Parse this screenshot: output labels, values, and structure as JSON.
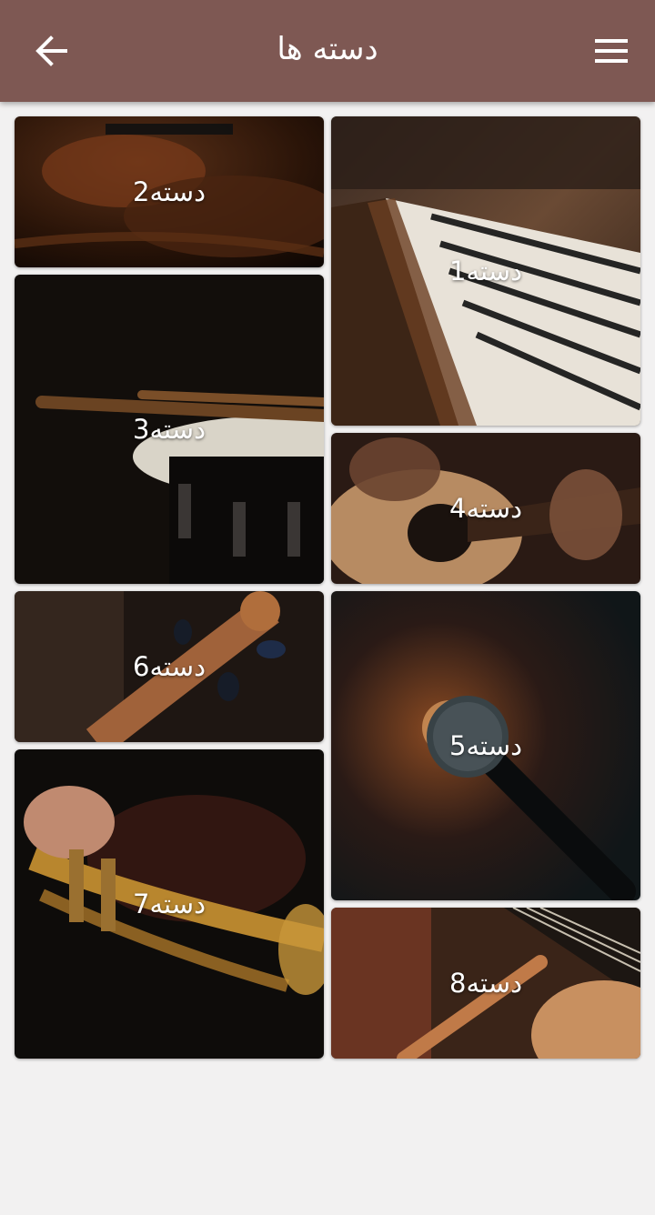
{
  "header": {
    "title": "دسته ها",
    "back_icon": "arrow-left-icon",
    "menu_icon": "hamburger-menu-icon",
    "background": "#7e5853"
  },
  "categories": [
    {
      "label": "دسته1",
      "image": "piano"
    },
    {
      "label": "دسته2",
      "image": "violin"
    },
    {
      "label": "دسته3",
      "image": "snare-drum"
    },
    {
      "label": "دسته4",
      "image": "acoustic-guitar"
    },
    {
      "label": "دسته5",
      "image": "microphone"
    },
    {
      "label": "دسته6",
      "image": "cello-scroll"
    },
    {
      "label": "دسته7",
      "image": "trumpet"
    },
    {
      "label": "دسته8",
      "image": "guitar-and-flute"
    }
  ]
}
